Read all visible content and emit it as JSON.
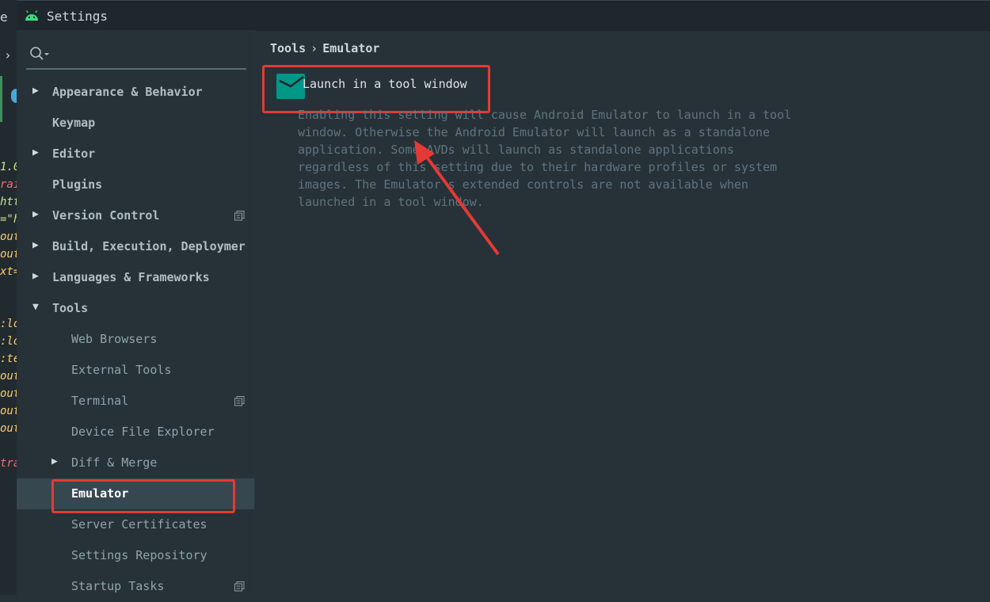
{
  "window": {
    "title": "Settings"
  },
  "editor_strip": {
    "tab_char": "e",
    "code_lines": [
      "1.0",
      "rai",
      "htt",
      "=\"h",
      "out",
      "out",
      "xt=",
      ":lo",
      ":lo",
      ":te",
      "out",
      "out",
      "out",
      "out",
      "tra"
    ]
  },
  "search": {
    "placeholder": "",
    "value": ""
  },
  "tree": {
    "appearance": "Appearance & Behavior",
    "keymap": "Keymap",
    "editor": "Editor",
    "plugins": "Plugins",
    "version_control": "Version Control",
    "build": "Build, Execution, Deploymer",
    "languages": "Languages & Frameworks",
    "tools": "Tools",
    "web_browsers": "Web Browsers",
    "external_tools": "External Tools",
    "terminal": "Terminal",
    "device_file_explorer": "Device File Explorer",
    "diff_merge": "Diff & Merge",
    "emulator": "Emulator",
    "server_certificates": "Server Certificates",
    "settings_repository": "Settings Repository",
    "startup_tasks": "Startup Tasks"
  },
  "breadcrumb": {
    "parent": "Tools",
    "separator": "›",
    "current": "Emulator"
  },
  "setting": {
    "label": "Launch in a tool window",
    "checked": true,
    "description": "Enabling this setting will cause Android Emulator to launch in a tool window. Otherwise the Android Emulator will launch as a standalone application. Some AVDs will launch as standalone applications regardless of this setting due to their hardware profiles or system images. The Emulator's extended controls are not available when launched in a tool window."
  },
  "colors": {
    "background": "#263238",
    "accent": "#009688",
    "selection": "#37474f",
    "annotation": "#e53935"
  }
}
